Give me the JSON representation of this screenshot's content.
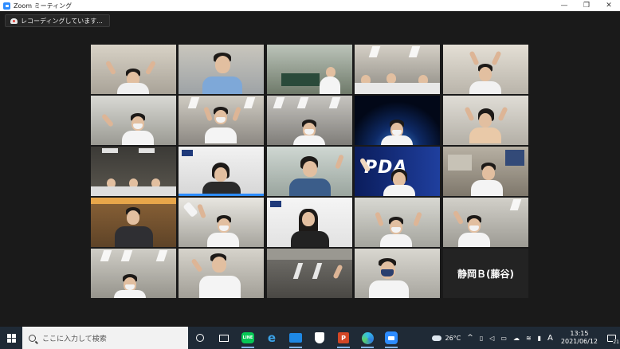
{
  "window": {
    "title": "Zoom ミーティング",
    "minimize": "—",
    "restore": "❐",
    "close": "✕"
  },
  "recording": {
    "label": "レコーディングしています..."
  },
  "participants": {
    "name_tile_label": "静岡Ｂ(藤谷)",
    "logo_text": "PDA"
  },
  "taskbar": {
    "search_placeholder": "ここに入力して検索",
    "line_label": "LINE",
    "ppt_label": "P",
    "edge_label": "e",
    "temperature": "26°C",
    "ime": "A",
    "time": "13:15",
    "date": "2021/06/12",
    "notification_count": "21"
  },
  "colors": {
    "active_speaker": "#c7e84a",
    "taskbar_bg": "#1f2a36",
    "zoom_blue": "#2d8cff"
  }
}
